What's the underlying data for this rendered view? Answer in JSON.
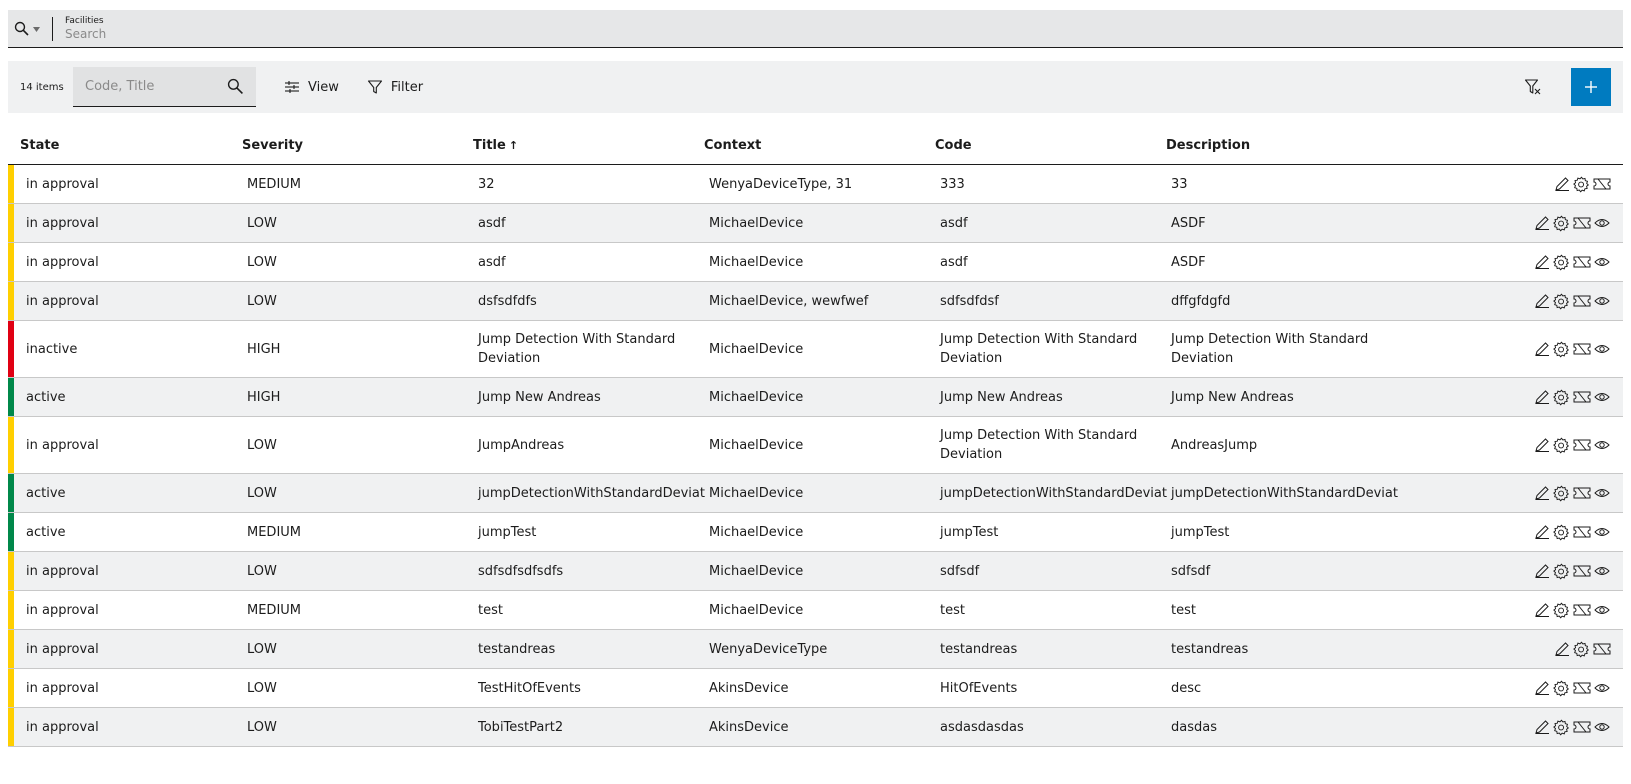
{
  "topbar": {
    "facility_label": "Facilities",
    "search_placeholder": "Search"
  },
  "toolbar": {
    "count": "14 items",
    "search_placeholder": "Code, Title",
    "view_label": "View",
    "filter_label": "Filter"
  },
  "colors": {
    "accent": "#007bc0",
    "in_approval": "#ffcf00",
    "inactive": "#e00013",
    "active": "#00884a"
  },
  "table": {
    "columns": {
      "state": "State",
      "severity": "Severity",
      "title": "Title",
      "title_sort": "↑",
      "context": "Context",
      "code": "Code",
      "description": "Description"
    },
    "rows": [
      {
        "state": "in approval",
        "severity": "MEDIUM",
        "title": "32",
        "context": "WenyaDeviceType, 31",
        "code": "333",
        "description": "33",
        "view_icon": false
      },
      {
        "state": "in approval",
        "severity": "LOW",
        "title": "asdf",
        "context": "MichaelDevice",
        "code": "asdf",
        "description": "ASDF",
        "view_icon": true
      },
      {
        "state": "in approval",
        "severity": "LOW",
        "title": "asdf",
        "context": "MichaelDevice",
        "code": "asdf",
        "description": "ASDF",
        "view_icon": true
      },
      {
        "state": "in approval",
        "severity": "LOW",
        "title": "dsfsdfdfs",
        "context": "MichaelDevice, wewfwef",
        "code": "sdfsdfdsf",
        "description": "dffgfdgfd",
        "view_icon": true
      },
      {
        "state": "inactive",
        "severity": "HIGH",
        "title": "Jump Detection With Standard Deviation",
        "context": "MichaelDevice",
        "code": "Jump Detection With Standard Deviation",
        "description": "Jump Detection With Standard Deviation",
        "view_icon": true
      },
      {
        "state": "active",
        "severity": "HIGH",
        "title": "Jump New Andreas",
        "context": "MichaelDevice",
        "code": "Jump New Andreas",
        "description": "Jump New Andreas",
        "view_icon": true
      },
      {
        "state": "in approval",
        "severity": "LOW",
        "title": "JumpAndreas",
        "context": "MichaelDevice",
        "code": "Jump Detection With Standard Deviation",
        "description": "AndreasJump",
        "view_icon": true
      },
      {
        "state": "active",
        "severity": "LOW",
        "title": "jumpDetectionWithStandardDeviat",
        "context": "MichaelDevice",
        "code": "jumpDetectionWithStandardDeviat",
        "description": "jumpDetectionWithStandardDeviat",
        "view_icon": true
      },
      {
        "state": "active",
        "severity": "MEDIUM",
        "title": "jumpTest",
        "context": "MichaelDevice",
        "code": "jumpTest",
        "description": "jumpTest",
        "view_icon": true
      },
      {
        "state": "in approval",
        "severity": "LOW",
        "title": "sdfsdfsdfsdfs",
        "context": "MichaelDevice",
        "code": "sdfsdf",
        "description": "sdfsdf",
        "view_icon": true
      },
      {
        "state": "in approval",
        "severity": "MEDIUM",
        "title": "test",
        "context": "MichaelDevice",
        "code": "test",
        "description": "test",
        "view_icon": true
      },
      {
        "state": "in approval",
        "severity": "LOW",
        "title": "testandreas",
        "context": "WenyaDeviceType",
        "code": "testandreas",
        "description": "testandreas",
        "view_icon": false
      },
      {
        "state": "in approval",
        "severity": "LOW",
        "title": "TestHitOfEvents",
        "context": "AkinsDevice",
        "code": "HitOfEvents",
        "description": "desc",
        "view_icon": true
      },
      {
        "state": "in approval",
        "severity": "LOW",
        "title": "TobiTestPart2",
        "context": "AkinsDevice",
        "code": "asdasdasdas",
        "description": "dasdas",
        "view_icon": true
      }
    ]
  }
}
